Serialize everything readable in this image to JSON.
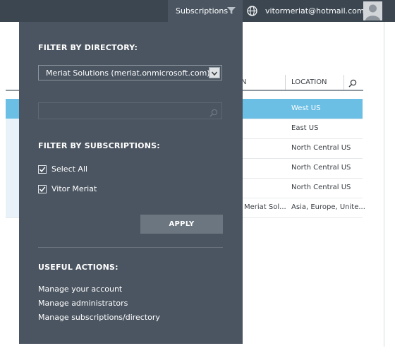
{
  "topbar": {
    "subscriptions_label": "Subscriptions",
    "email": "vitormeriat@hotmail.com",
    "icons": [
      "filter-icon",
      "globe-icon",
      "user-avatar-icon"
    ]
  },
  "table": {
    "columns": [
      "N",
      "LOCATION"
    ],
    "rows": [
      {
        "name": "",
        "location": "West US",
        "selected": true
      },
      {
        "name": "",
        "location": "East US",
        "selected": false
      },
      {
        "name": "",
        "location": "North Central US",
        "selected": false
      },
      {
        "name": "",
        "location": "North Central US",
        "selected": false
      },
      {
        "name": "",
        "location": "North Central US",
        "selected": false
      },
      {
        "name": "Meriat Sol...",
        "location": "Asia, Europe, Unite...",
        "selected": false
      }
    ]
  },
  "panel": {
    "directory_title": "FILTER BY DIRECTORY:",
    "directory_selected": "Meriat Solutions (meriat.onmicrosoft.com)",
    "search_placeholder": "",
    "subscriptions_title": "FILTER BY SUBSCRIPTIONS:",
    "subscriptions": [
      {
        "label": "Select All",
        "checked": true
      },
      {
        "label": "Vitor Meriat",
        "checked": true
      }
    ],
    "apply_label": "APPLY",
    "actions_title": "USEFUL ACTIONS:",
    "actions": [
      "Manage your account",
      "Manage administrators",
      "Manage subscriptions/directory"
    ]
  },
  "colors": {
    "topbar": "#3b4650",
    "panel": "#4b5561",
    "selected_row": "#6bbfe5",
    "apply_button": "#6c7680"
  }
}
